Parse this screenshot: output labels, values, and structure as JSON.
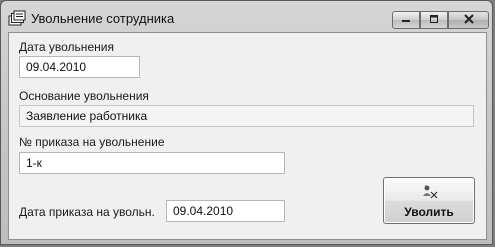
{
  "window": {
    "title": "Увольнение сотрудника",
    "icon": "stacked-documents-icon",
    "controls": [
      "minimize-icon",
      "maximize-icon",
      "close-icon"
    ]
  },
  "form": {
    "dismissal_date": {
      "label": "Дата увольнения",
      "value": "09.04.2010"
    },
    "reason": {
      "label": "Основание увольнения",
      "value": "Заявление работника"
    },
    "order_number": {
      "label": "№ приказа на увольнение",
      "value": "1-к"
    },
    "order_date": {
      "label": "Дата приказа на увольн.",
      "value": "09.04.2010"
    }
  },
  "actions": {
    "dismiss": {
      "label": "Уволить",
      "icon": "dismiss-user-icon"
    }
  }
}
